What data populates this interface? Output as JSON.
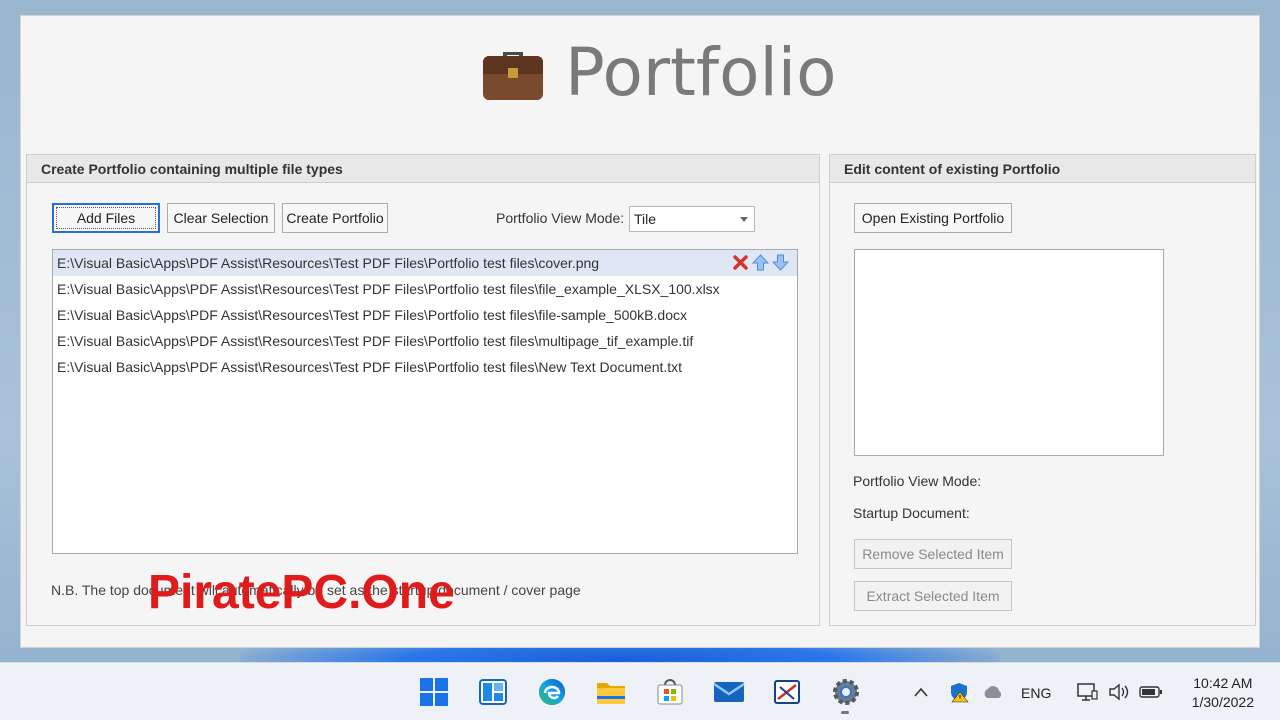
{
  "app": {
    "title": "Portfolio"
  },
  "create_panel": {
    "title": "Create Portfolio containing multiple file types",
    "add_files_label": "Add Files",
    "clear_selection_label": "Clear Selection",
    "create_portfolio_label": "Create Portfolio",
    "view_mode_label": "Portfolio View Mode:",
    "view_mode_value": "Tile",
    "files": [
      "E:\\Visual Basic\\Apps\\PDF Assist\\Resources\\Test PDF Files\\Portfolio test files\\cover.png",
      "E:\\Visual Basic\\Apps\\PDF Assist\\Resources\\Test PDF Files\\Portfolio test files\\file_example_XLSX_100.xlsx",
      "E:\\Visual Basic\\Apps\\PDF Assist\\Resources\\Test PDF Files\\Portfolio test files\\file-sample_500kB.docx",
      "E:\\Visual Basic\\Apps\\PDF Assist\\Resources\\Test PDF Files\\Portfolio test files\\multipage_tif_example.tif",
      "E:\\Visual Basic\\Apps\\PDF Assist\\Resources\\Test PDF Files\\Portfolio test files\\New Text Document.txt"
    ],
    "note": "N.B. The top document will automatically be set as the startup document / cover page"
  },
  "edit_panel": {
    "title": "Edit content of existing Portfolio",
    "open_existing_label": "Open Existing Portfolio",
    "view_mode_label": "Portfolio View Mode:",
    "startup_document_label": "Startup Document:",
    "remove_selected_label": "Remove Selected Item",
    "extract_selected_label": "Extract Selected Item"
  },
  "watermark": "PiratePC.One",
  "taskbar": {
    "language": "ENG",
    "time": "10:42 AM",
    "date": "1/30/2022",
    "pinned_icons": [
      "windows-start-icon",
      "widgets-icon",
      "edge-icon",
      "file-explorer-icon",
      "store-icon",
      "mail-icon",
      "snipping-tool-icon",
      "settings-icon"
    ]
  },
  "colors": {
    "accent": "#2b6fd6",
    "selection": "#dfe7f5",
    "delete_red": "#d9342b",
    "arrow_blue": "#4a8ee0",
    "watermark_red": "#e01b1b"
  }
}
